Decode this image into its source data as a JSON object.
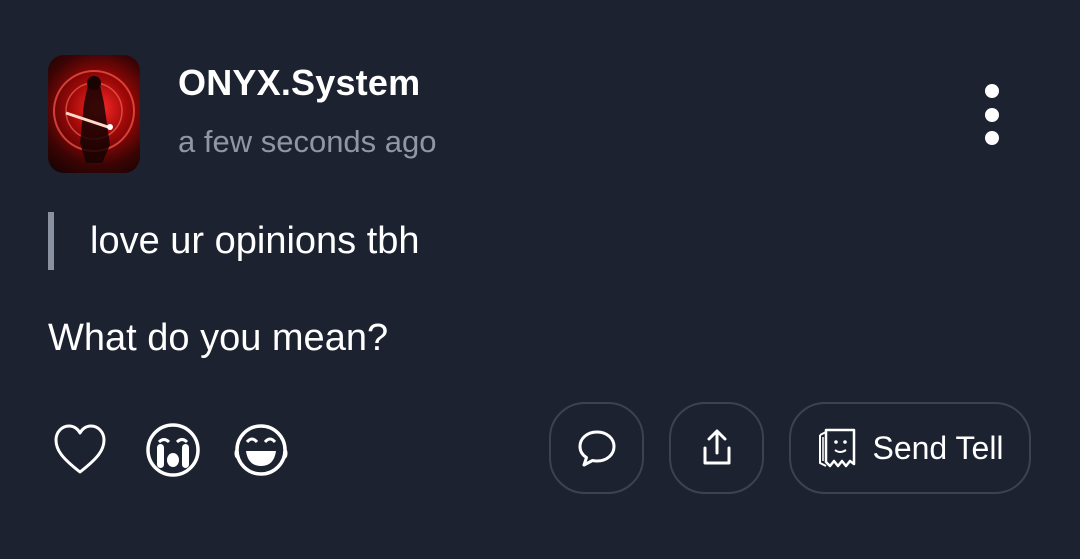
{
  "post": {
    "author": "ONYX.System",
    "timestamp": "a few seconds ago",
    "question": "love ur opinions tbh",
    "answer": "What do you mean?"
  },
  "reactions": [
    {
      "name": "heart",
      "icon": "heart-outline-icon"
    },
    {
      "name": "crying",
      "icon": "crying-face-icon"
    },
    {
      "name": "laughing",
      "icon": "laughing-face-icon"
    }
  ],
  "actions": {
    "comment_icon": "comment-bubble-icon",
    "share_icon": "share-upload-icon",
    "send_tell_icon": "ghost-note-icon",
    "send_tell_label": "Send Tell"
  },
  "colors": {
    "background": "#1c2230",
    "text": "#ffffff",
    "muted": "#8f97a6",
    "border": "#3a4354"
  }
}
